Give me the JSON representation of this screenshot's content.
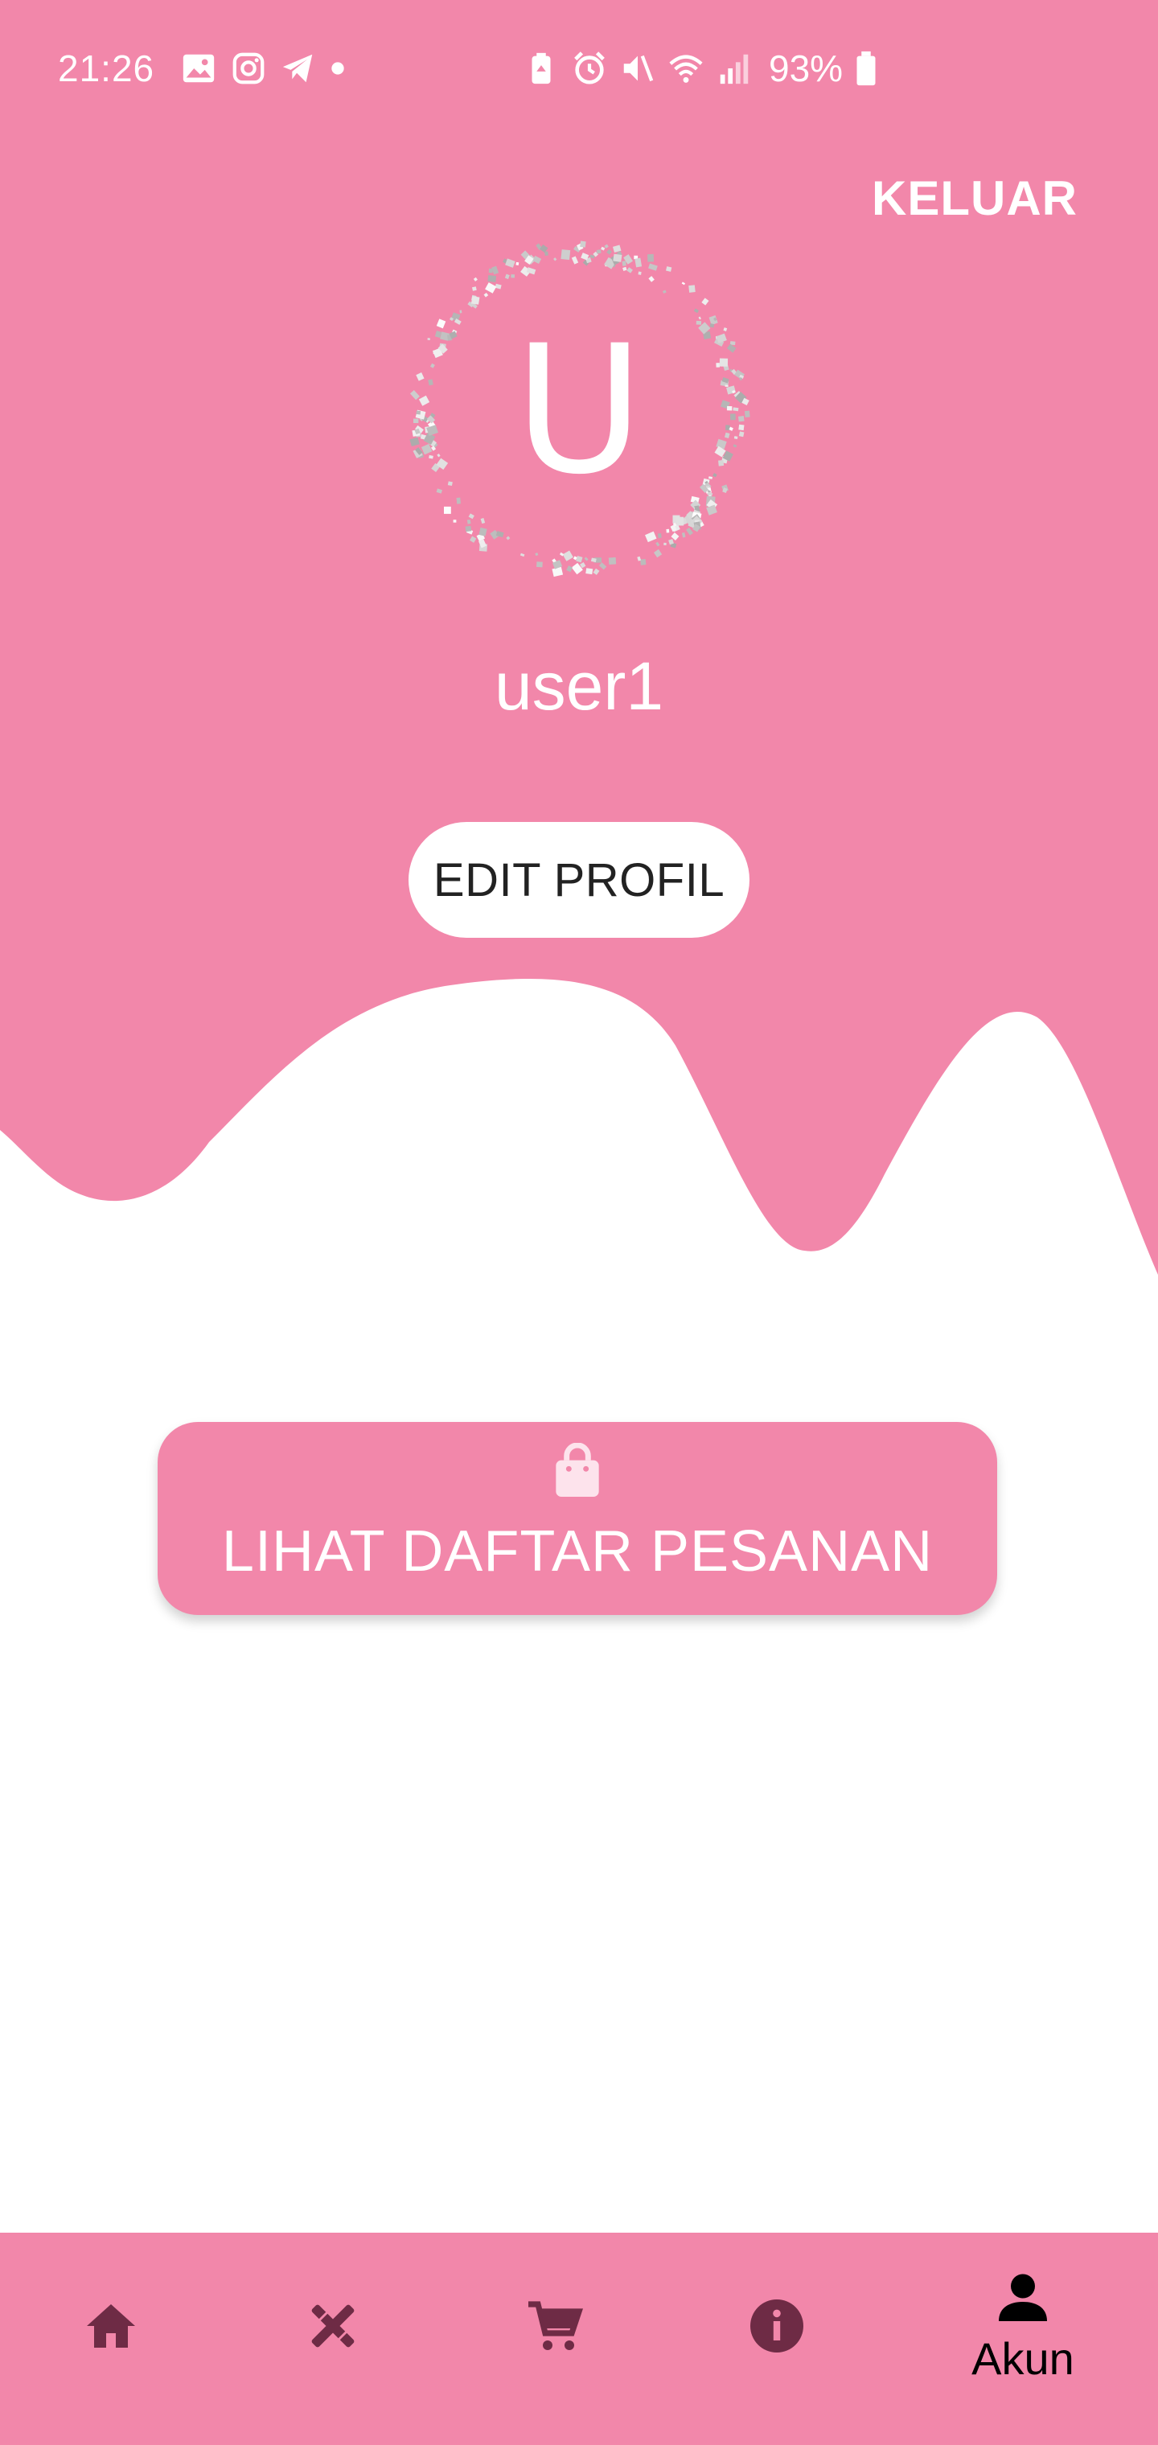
{
  "status_bar": {
    "time": "21:26",
    "battery_percent": "93%"
  },
  "header": {
    "logout_label": "KELUAR",
    "avatar_letter": "U",
    "username": "user1",
    "edit_profile_label": "EDIT PROFIL"
  },
  "main": {
    "orders_button_label": "LIHAT DAFTAR PESANAN",
    "orders_icon": "shopping-bag-icon"
  },
  "bottom_nav": {
    "items": [
      {
        "icon": "home-icon",
        "label": ""
      },
      {
        "icon": "tools-icon",
        "label": ""
      },
      {
        "icon": "cart-icon",
        "label": ""
      },
      {
        "icon": "info-icon",
        "label": ""
      },
      {
        "icon": "person-icon",
        "label": "Akun",
        "active": true
      }
    ]
  },
  "colors": {
    "primary_pink": "#f287aa",
    "icon_dark": "#6e2b45",
    "white": "#ffffff"
  }
}
